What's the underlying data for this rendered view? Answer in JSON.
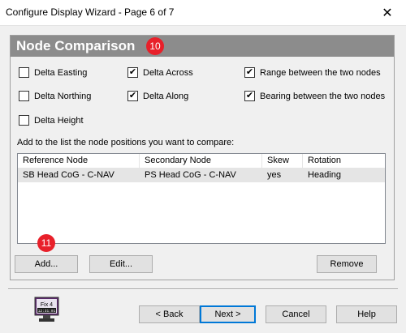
{
  "window": {
    "title": "Configure Display Wizard - Page 6 of 7",
    "close_glyph": "✕"
  },
  "panel": {
    "title": "Node Comparison",
    "badge": "10"
  },
  "options": [
    {
      "label": "Delta Easting",
      "checked": false
    },
    {
      "label": "Delta Across",
      "checked": true
    },
    {
      "label": "Range between the two nodes",
      "checked": true
    },
    {
      "label": "Delta Northing",
      "checked": false
    },
    {
      "label": "Delta Along",
      "checked": true
    },
    {
      "label": "Bearing between the two nodes",
      "checked": true
    },
    {
      "label": "Delta Height",
      "checked": false
    }
  ],
  "list_label": "Add to the list the node positions you want to compare:",
  "table": {
    "columns": [
      "Reference Node",
      "Secondary Node",
      "Skew",
      "Rotation"
    ],
    "rows": [
      [
        "SB Head CoG - C-NAV",
        "PS Head CoG - C-NAV",
        "yes",
        "Heading"
      ]
    ]
  },
  "list_buttons": {
    "add": "Add...",
    "edit": "Edit...",
    "remove": "Remove",
    "badge": "11"
  },
  "logo": {
    "text": "Fix 4",
    "sub": "12:31:01",
    "icon": "fix4-monitor-icon"
  },
  "nav": {
    "back": "< Back",
    "next": "Next >",
    "cancel": "Cancel",
    "help": "Help"
  },
  "colors": {
    "header": "#8c8c8c",
    "badge": "#e8202a",
    "default_button": "#0078d7",
    "selected_row": "#e5e5e5"
  }
}
